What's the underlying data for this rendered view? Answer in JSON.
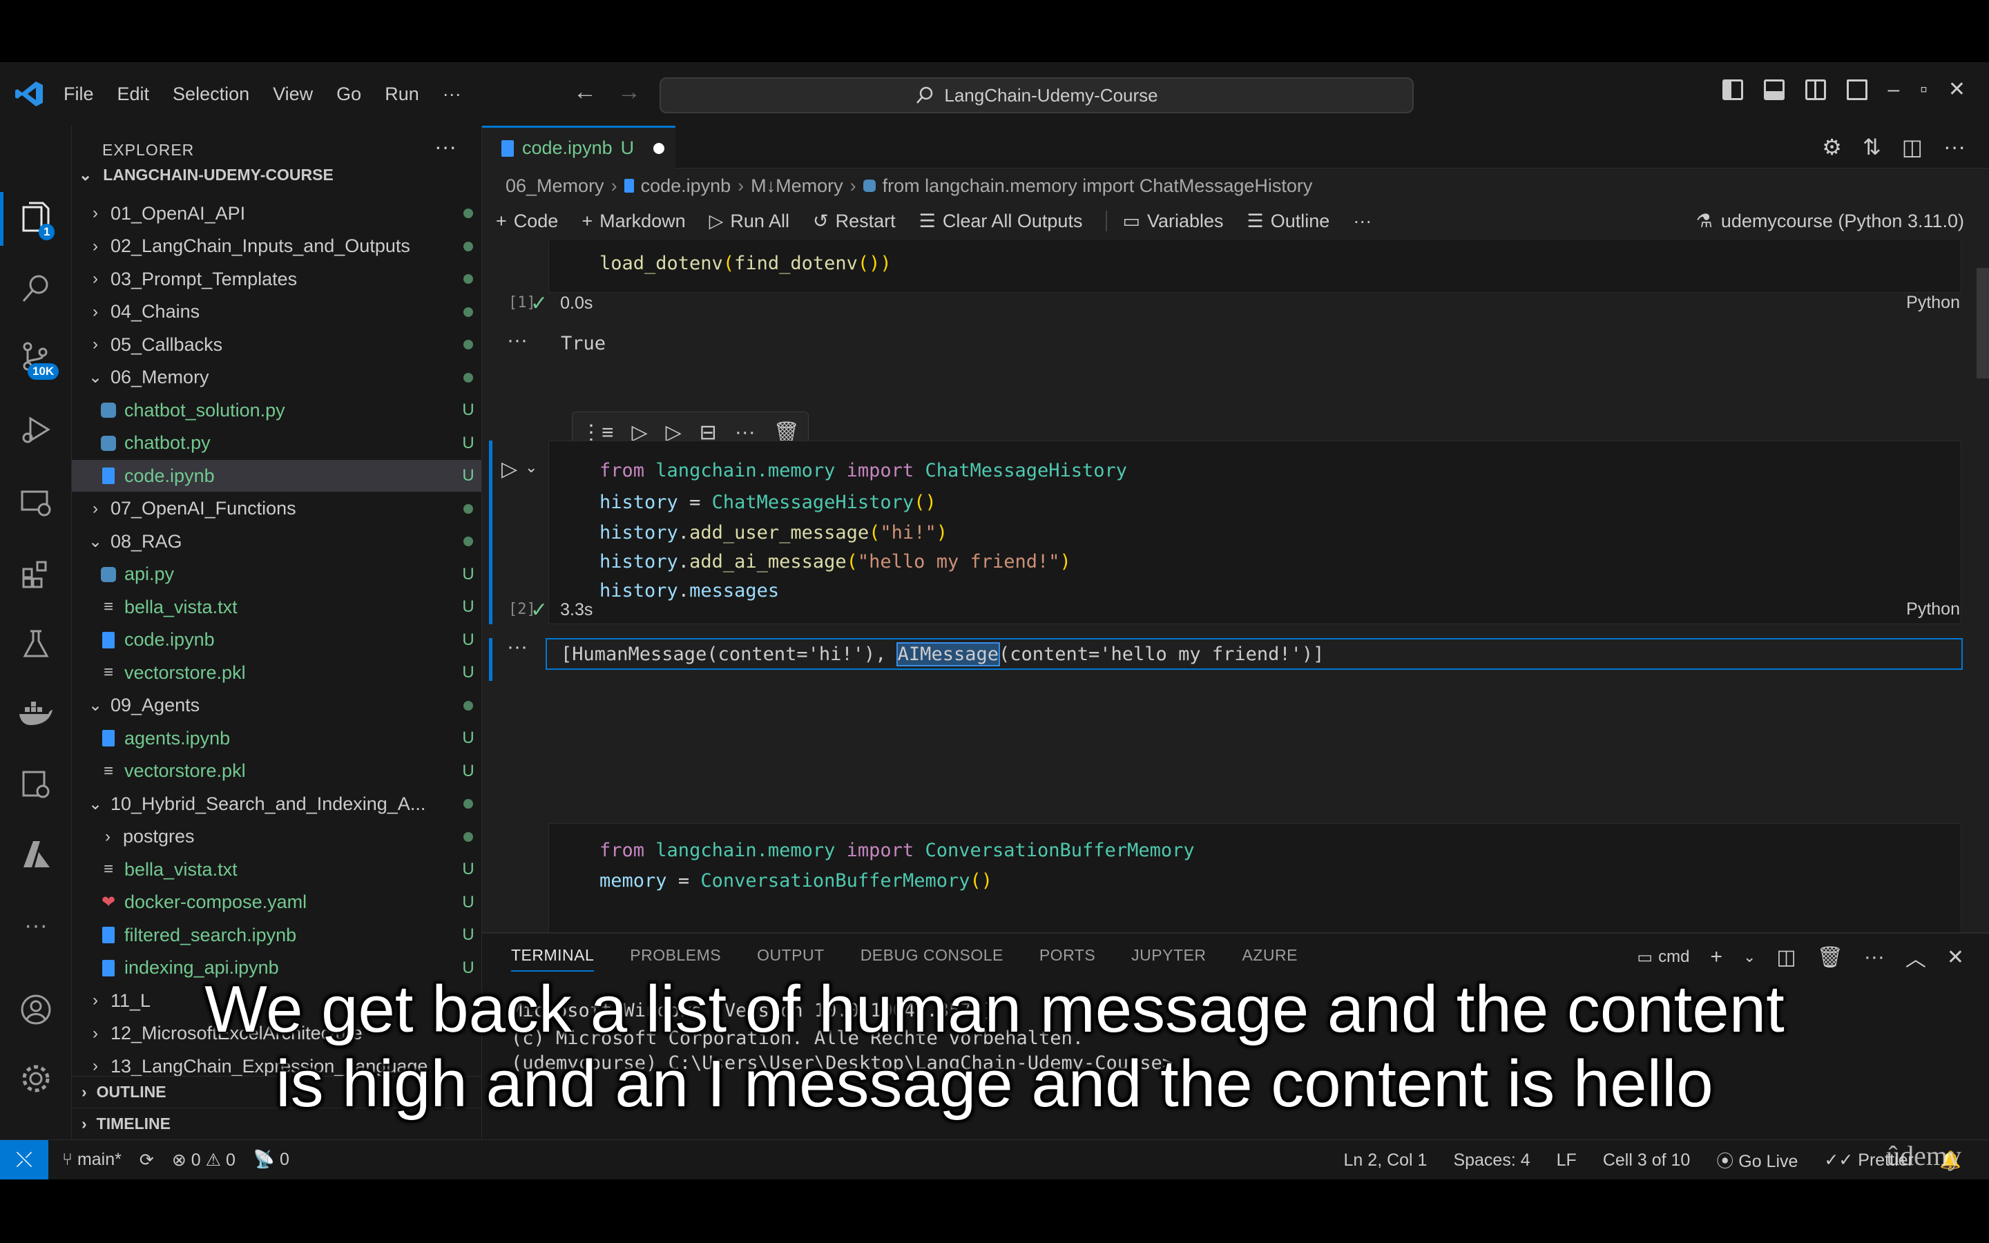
{
  "menu": [
    "File",
    "Edit",
    "Selection",
    "View",
    "Go",
    "Run",
    "···"
  ],
  "command_center": "LangChain-Udemy-Course",
  "activity_badges": {
    "explorer": "1",
    "scm": "10K"
  },
  "sidebar": {
    "header": "EXPLORER",
    "project": "LANGCHAIN-UDEMY-COURSE",
    "items": [
      {
        "label": "01_OpenAI_API",
        "type": "folder",
        "open": false,
        "indent": 0,
        "status": "dot"
      },
      {
        "label": "02_LangChain_Inputs_and_Outputs",
        "type": "folder",
        "open": false,
        "indent": 0,
        "status": "dot"
      },
      {
        "label": "03_Prompt_Templates",
        "type": "folder",
        "open": false,
        "indent": 0,
        "status": "dot"
      },
      {
        "label": "04_Chains",
        "type": "folder",
        "open": false,
        "indent": 0,
        "status": "dot"
      },
      {
        "label": "05_Callbacks",
        "type": "folder",
        "open": false,
        "indent": 0,
        "status": "dot"
      },
      {
        "label": "06_Memory",
        "type": "folder",
        "open": true,
        "indent": 0,
        "status": "dot"
      },
      {
        "label": "chatbot_solution.py",
        "type": "py",
        "indent": 1,
        "status": "U"
      },
      {
        "label": "chatbot.py",
        "type": "py",
        "indent": 1,
        "status": "U"
      },
      {
        "label": "code.ipynb",
        "type": "nb",
        "indent": 1,
        "status": "U",
        "selected": true
      },
      {
        "label": "07_OpenAI_Functions",
        "type": "folder",
        "open": false,
        "indent": 0,
        "status": "dot"
      },
      {
        "label": "08_RAG",
        "type": "folder",
        "open": true,
        "indent": 0,
        "status": "dot"
      },
      {
        "label": "api.py",
        "type": "py",
        "indent": 1,
        "status": "U"
      },
      {
        "label": "bella_vista.txt",
        "type": "txt",
        "indent": 1,
        "status": "U"
      },
      {
        "label": "code.ipynb",
        "type": "nb",
        "indent": 1,
        "status": "U"
      },
      {
        "label": "vectorstore.pkl",
        "type": "txt",
        "indent": 1,
        "status": "U"
      },
      {
        "label": "09_Agents",
        "type": "folder",
        "open": true,
        "indent": 0,
        "status": "dot"
      },
      {
        "label": "agents.ipynb",
        "type": "nb",
        "indent": 1,
        "status": "U"
      },
      {
        "label": "vectorstore.pkl",
        "type": "txt",
        "indent": 1,
        "status": "U"
      },
      {
        "label": "10_Hybrid_Search_and_Indexing_A...",
        "type": "folder",
        "open": true,
        "indent": 0,
        "status": "dot"
      },
      {
        "label": "postgres",
        "type": "folder",
        "open": false,
        "indent": 1,
        "status": "dot"
      },
      {
        "label": "bella_vista.txt",
        "type": "txt",
        "indent": 1,
        "status": "U"
      },
      {
        "label": "docker-compose.yaml",
        "type": "yml",
        "indent": 1,
        "status": "U"
      },
      {
        "label": "filtered_search.ipynb",
        "type": "nb",
        "indent": 1,
        "status": "U"
      },
      {
        "label": "indexing_api.ipynb",
        "type": "nb",
        "indent": 1,
        "status": "U"
      },
      {
        "label": "11_L",
        "type": "folder",
        "open": false,
        "indent": 0,
        "status": ""
      },
      {
        "label": "12_MicrosoftExcelArchitecture",
        "type": "folder",
        "open": false,
        "indent": 0,
        "status": ""
      },
      {
        "label": "13_LangChain_Expression_Language",
        "type": "folder",
        "open": false,
        "indent": 0,
        "status": ""
      }
    ],
    "outline": "OUTLINE",
    "timeline": "TIMELINE"
  },
  "tab": {
    "label": "code.ipynb",
    "status": "U"
  },
  "breadcrumb": [
    "06_Memory",
    "code.ipynb",
    "M↓Memory",
    "from langchain.memory import ChatMessageHistory"
  ],
  "toolbar": {
    "code": "Code",
    "markdown": "Markdown",
    "run_all": "Run All",
    "restart": "Restart",
    "clear": "Clear All Outputs",
    "variables": "Variables",
    "outline": "Outline",
    "more": "···"
  },
  "kernel": "udemycourse (Python 3.11.0)",
  "cells": {
    "c1": {
      "count": "[1]",
      "time": "0.0s",
      "lang": "Python",
      "output": "True"
    },
    "c2": {
      "count": "[2]",
      "time": "3.3s",
      "lang": "Python"
    },
    "c2_output": {
      "part1": "[HumanMessage(content='hi!'), ",
      "highlight": "AIMessage",
      "part2": "(content='hello my friend!')]"
    }
  },
  "panel": {
    "tabs": [
      "TERMINAL",
      "PROBLEMS",
      "OUTPUT",
      "DEBUG CONSOLE",
      "PORTS",
      "JUPYTER",
      "AZURE"
    ],
    "shell": "cmd",
    "lines": [
      "Microsoft Windows [Version 10.0.19045.3570]",
      "(c) Microsoft Corporation. Alle Rechte vorbehalten.",
      "",
      "(udemycourse) C:\\Users\\User\\Desktop\\LangChain-Udemy-Course>"
    ]
  },
  "status": {
    "branch": "main*",
    "errors": "0",
    "warnings": "0",
    "ports": "0",
    "position": "Ln 2, Col 1",
    "spaces": "Spaces: 4",
    "eol": "LF",
    "cell": "Cell 3 of 10",
    "golive": "Go Live",
    "prettier": "Prettier"
  },
  "caption": {
    "line1": "We get back a list of human message and the content",
    "line2": "is high and an I message and the content is hello"
  },
  "watermark": "ûdemy",
  "colors": {
    "accent": "#0078d4",
    "untracked": "#73c991",
    "bg": "#1f1f1f"
  }
}
